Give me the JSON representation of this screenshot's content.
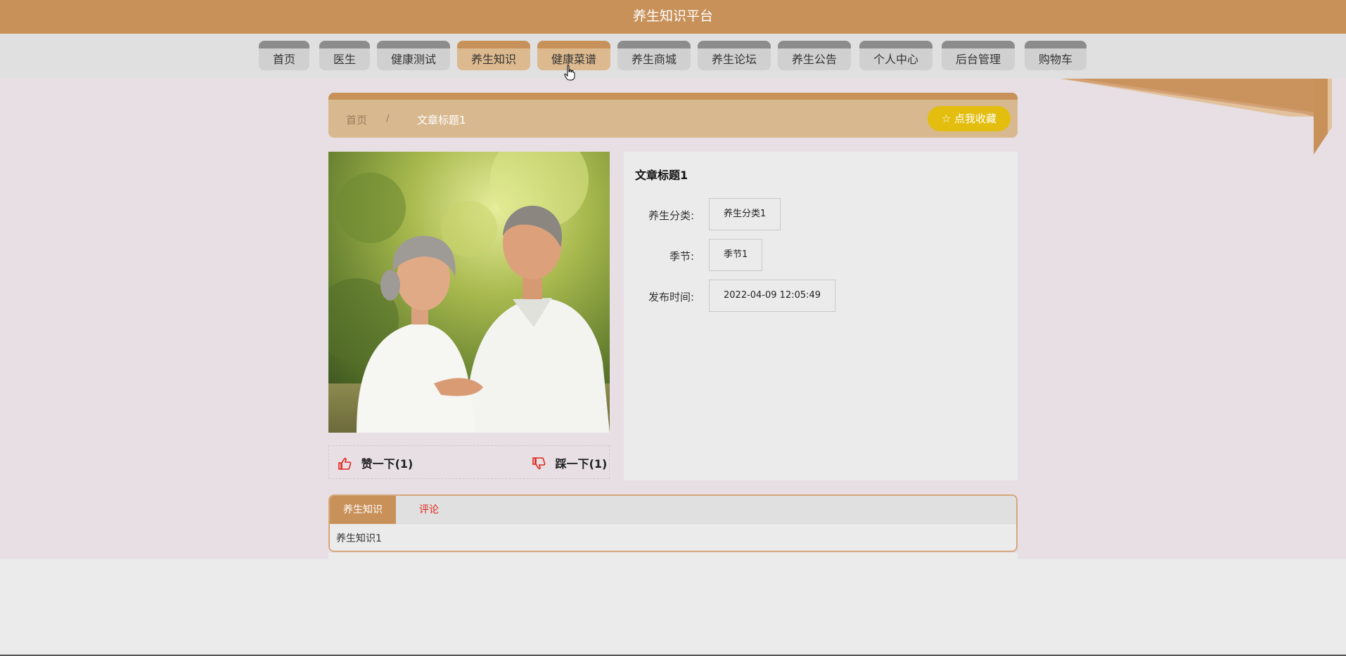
{
  "app": {
    "title": "养生知识平台"
  },
  "nav": {
    "items": [
      {
        "label": "首页"
      },
      {
        "label": "医生"
      },
      {
        "label": "健康测试"
      },
      {
        "label": "养生知识"
      },
      {
        "label": "健康菜谱"
      },
      {
        "label": "养生商城"
      },
      {
        "label": "养生论坛"
      },
      {
        "label": "养生公告"
      },
      {
        "label": "个人中心"
      },
      {
        "label": "后台管理"
      },
      {
        "label": "购物车"
      }
    ]
  },
  "breadcrumb": {
    "home": "首页",
    "separator": "/",
    "current": "文章标题1"
  },
  "favorite_button": {
    "label": "点我收藏",
    "icon": "star-outline-icon"
  },
  "article": {
    "title": "文章标题1",
    "fields": [
      {
        "label": "养生分类:",
        "value": "养生分类1"
      },
      {
        "label": "季节:",
        "value": "季节1"
      },
      {
        "label": "发布时间:",
        "value": "2022-04-09 12:05:49"
      }
    ]
  },
  "votes": {
    "like": {
      "label": "赞一下(1)",
      "icon": "thumbs-up-icon"
    },
    "dislike": {
      "label": "踩一下(1)",
      "icon": "thumbs-down-icon"
    }
  },
  "tabs": {
    "items": [
      {
        "label": "养生知识"
      },
      {
        "label": "评论"
      }
    ],
    "content": "养生知识1"
  },
  "colors": {
    "accent": "#c8915a",
    "accent_light": "#dcb98e",
    "favorite": "#e3be0f",
    "vote_icon": "#e1261c"
  }
}
